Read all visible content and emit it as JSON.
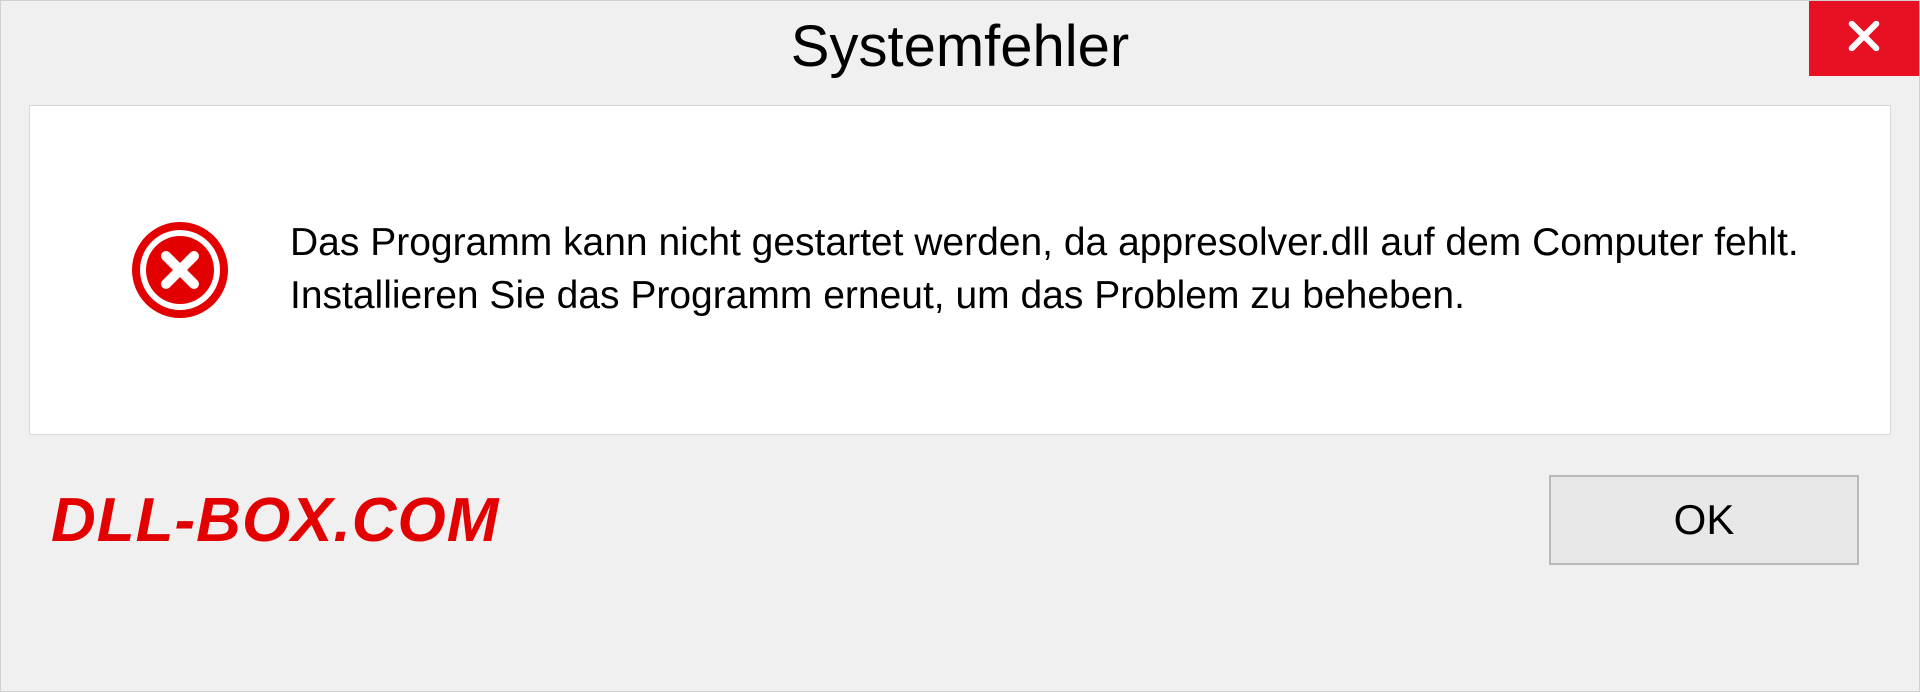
{
  "dialog": {
    "title": "Systemfehler",
    "message": "Das Programm kann nicht gestartet werden, da appresolver.dll auf dem Computer fehlt. Installieren Sie das Programm erneut, um das Problem zu beheben.",
    "ok_label": "OK"
  },
  "watermark": "DLL-BOX.COM",
  "colors": {
    "close_bg": "#e81123",
    "error_icon": "#e20000",
    "watermark": "#e20000"
  }
}
